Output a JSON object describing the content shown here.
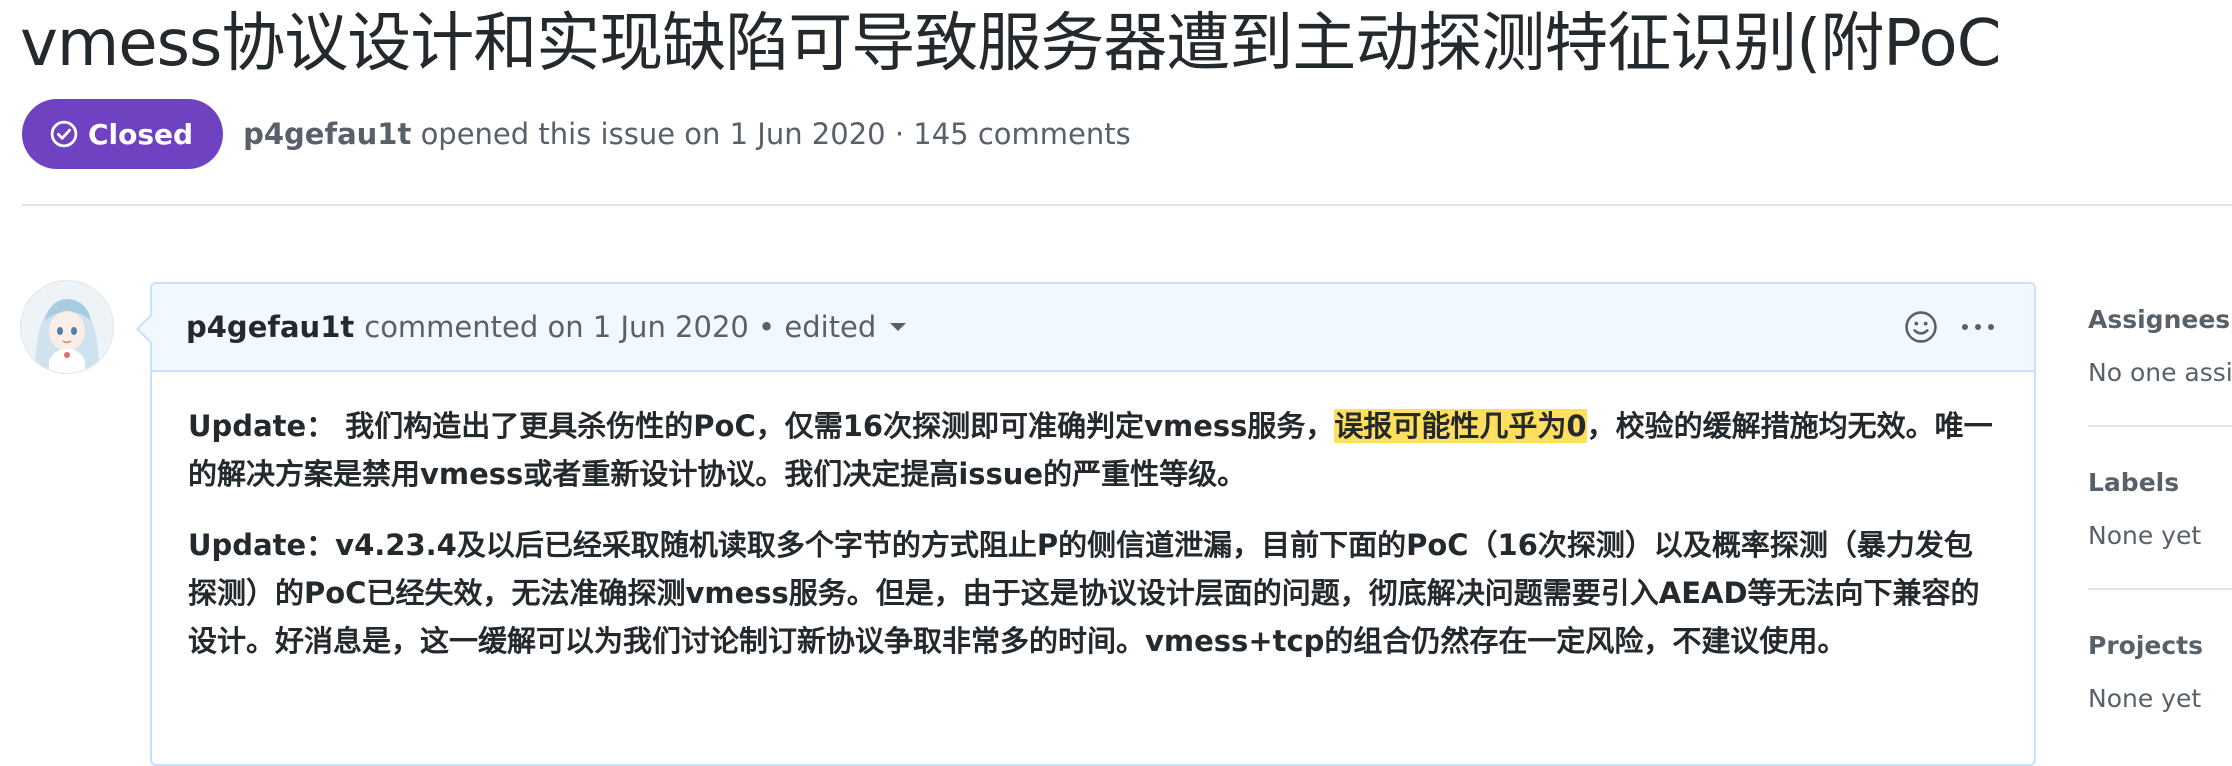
{
  "issue": {
    "title": "vmess协议设计和实现缺陷可导致服务器遭到主动探测特征识别(附PoC",
    "state": "Closed",
    "author": "p4gefau1t",
    "meta": "opened this issue on 1 Jun 2020 · 145 comments"
  },
  "comment": {
    "author": "p4gefau1t",
    "meta": "commented on 1 Jun 2020 • edited",
    "paragraph1_before": "Update： 我们构造出了更具杀伤性的PoC，仅需16次探测即可准确判定vmess服务，",
    "paragraph1_highlight": "误报可能性几乎为0",
    "paragraph1_after": "，校验的缓解措施均无效。唯一的解决方案是禁用vmess或者重新设计协议。我们决定提高issue的严重性等级。",
    "paragraph2": "Update：v4.23.4及以后已经采取随机读取多个字节的方式阻止P的侧信道泄漏，目前下面的PoC（16次探测）以及概率探测（暴力发包探测）的PoC已经失效，无法准确探测vmess服务。但是，由于这是协议设计层面的问题，彻底解决问题需要引入AEAD等无法向下兼容的设计。好消息是，这一缓解可以为我们讨论制订新协议争取非常多的时间。vmess+tcp的组合仍然存在一定风险，不建议使用。"
  },
  "sidebar": {
    "assignees_title": "Assignees",
    "assignees_value": "No one assigned",
    "labels_title": "Labels",
    "labels_value": "None yet",
    "projects_title": "Projects",
    "projects_value": "None yet"
  },
  "colors": {
    "closed_badge": "#6f42c1",
    "comment_border": "#c8e1ff",
    "comment_header_bg": "#f1f8ff",
    "highlight": "#ffdf5d"
  },
  "icons": [
    "check-circle-icon",
    "smiley-icon",
    "kebab-horizontal-icon",
    "caret-down-icon"
  ]
}
